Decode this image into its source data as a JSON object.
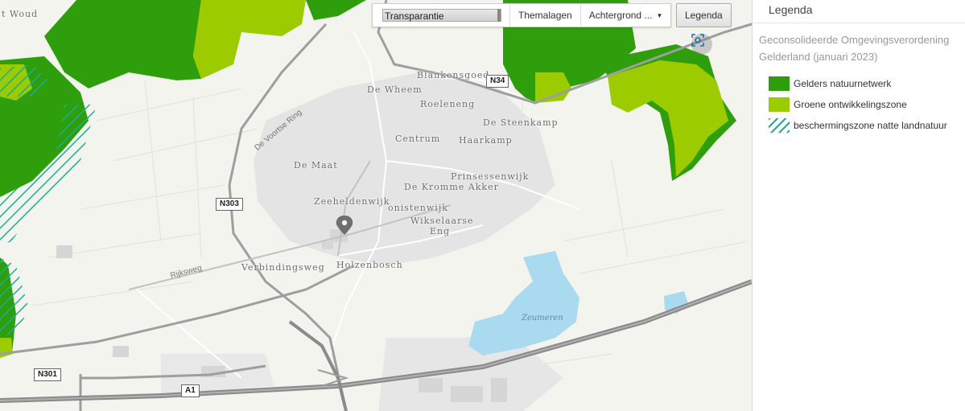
{
  "toolbar": {
    "transparency_label": "Transparantie",
    "themes_label": "Themalagen",
    "background_label": "Achtergrond ...",
    "legend_button": "Legenda"
  },
  "map": {
    "places": [
      "t Woud",
      "Blankensgoed",
      "De Wheem",
      "Roeleneng",
      "De Steenkamp",
      "Centrum",
      "Haarkamp",
      "De Maat",
      "Prinsessenwijk",
      "De Kromme Akker",
      "Zeeheldenwijk",
      "onistenwijk",
      "Wikselaarse",
      "Eng",
      "Verbindingsweg",
      "Holzenbosch"
    ],
    "water": "Zeumeren",
    "shields": [
      "N303",
      "N301",
      "A1",
      "N34"
    ],
    "road_labels": [
      "De Voortse Ring",
      "Rijksweg"
    ]
  },
  "panel": {
    "title": "Legenda",
    "subtitle": "Geconsolideerde Omgevingsverordening Gelderland (januari 2023)",
    "items": [
      {
        "label": "Gelders natuurnetwerk",
        "color": "#2f9e0c"
      },
      {
        "label": "Groene ontwikkelingszone",
        "color": "#9ccc00"
      },
      {
        "label": "beschermingszone natte landnatuur",
        "color": "#1aae96"
      }
    ]
  }
}
